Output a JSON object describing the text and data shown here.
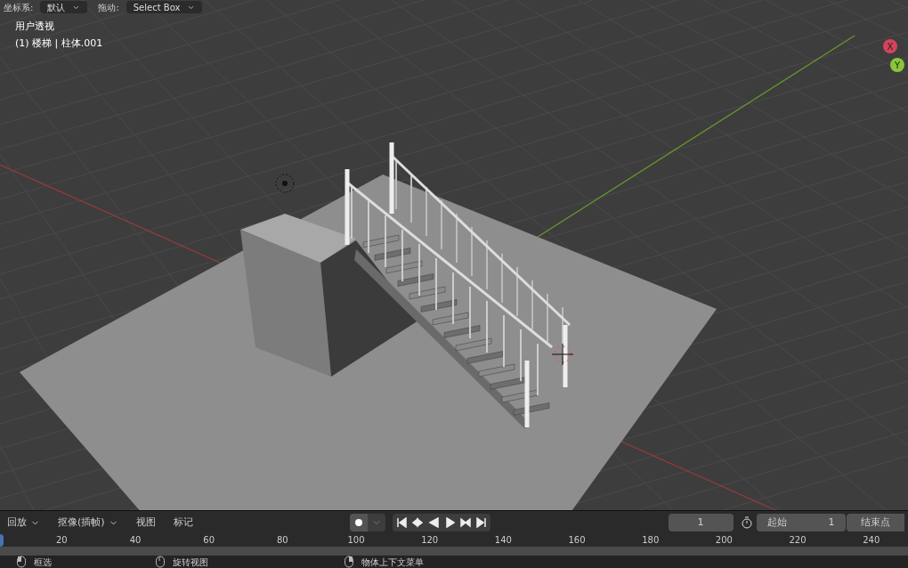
{
  "header": {
    "fields": [
      {
        "label": "坐标系:",
        "value": "默认"
      },
      {
        "label": "拖动:",
        "value": "Select Box"
      }
    ]
  },
  "viewport": {
    "view_name": "用户透视",
    "object_info": "(1) 楼梯 | 柱体.001",
    "gizmo": [
      {
        "axis": "X",
        "color": "#d5435a"
      },
      {
        "axis": "Y",
        "color": "#8bc53a"
      }
    ]
  },
  "timeline": {
    "menus": [
      {
        "label": "回放",
        "dropdown": true
      },
      {
        "label": "抠像(插帧)",
        "dropdown": true
      },
      {
        "label": "视图",
        "dropdown": false
      },
      {
        "label": "标记",
        "dropdown": false
      }
    ],
    "current_frame": "1",
    "start_label": "起始",
    "start": "1",
    "end_label": "结束点",
    "ruler": [
      "20",
      "40",
      "60",
      "80",
      "100",
      "120",
      "140",
      "160",
      "180",
      "200",
      "220",
      "240"
    ]
  },
  "status_bar": [
    {
      "kind": "left",
      "label": "框选"
    },
    {
      "kind": "middle",
      "label": "旋转视图"
    },
    {
      "kind": "right",
      "label": "物体上下文菜单"
    }
  ]
}
